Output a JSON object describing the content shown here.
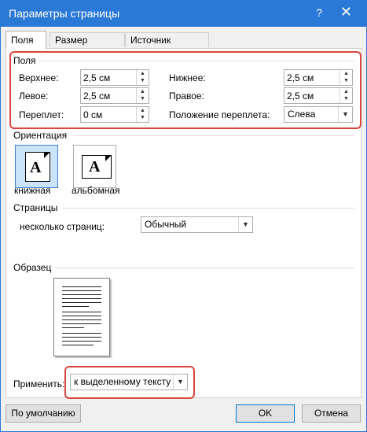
{
  "window": {
    "title": "Параметры страницы",
    "help_glyph": "?",
    "close_glyph": "✕"
  },
  "tabs": [
    {
      "label": "Поля",
      "active": true
    },
    {
      "label": "Размер бумаги",
      "active": false
    },
    {
      "label": "Источник бумаги",
      "active": false
    }
  ],
  "margins": {
    "group_label": "Поля",
    "top": {
      "label": "Верхнее:",
      "value": "2,5 см"
    },
    "bottom": {
      "label": "Нижнее:",
      "value": "2,5 см"
    },
    "left": {
      "label": "Левое:",
      "value": "2,5 см"
    },
    "right": {
      "label": "Правое:",
      "value": "2,5 см"
    },
    "gutter": {
      "label": "Переплет:",
      "value": "0 см"
    },
    "gutter_position": {
      "label": "Положение переплета:",
      "value": "Слева"
    }
  },
  "orientation": {
    "group_label": "Ориентация",
    "portrait_label": "книжная",
    "landscape_label": "альбомная",
    "icon_letter": "A",
    "selected": "portrait"
  },
  "pages": {
    "group_label": "Страницы",
    "multiple_label": "несколько страниц:",
    "multiple_value": "Обычный"
  },
  "preview": {
    "group_label": "Образец"
  },
  "apply": {
    "label": "Применить:",
    "value": "к выделенному тексту"
  },
  "buttons": {
    "default": "По умолчанию",
    "ok": "OK",
    "cancel": "Отмена"
  },
  "colors": {
    "titlebar": "#2b79d7",
    "highlight": "#d9473d",
    "selected_orientation": "#cce4f7"
  }
}
